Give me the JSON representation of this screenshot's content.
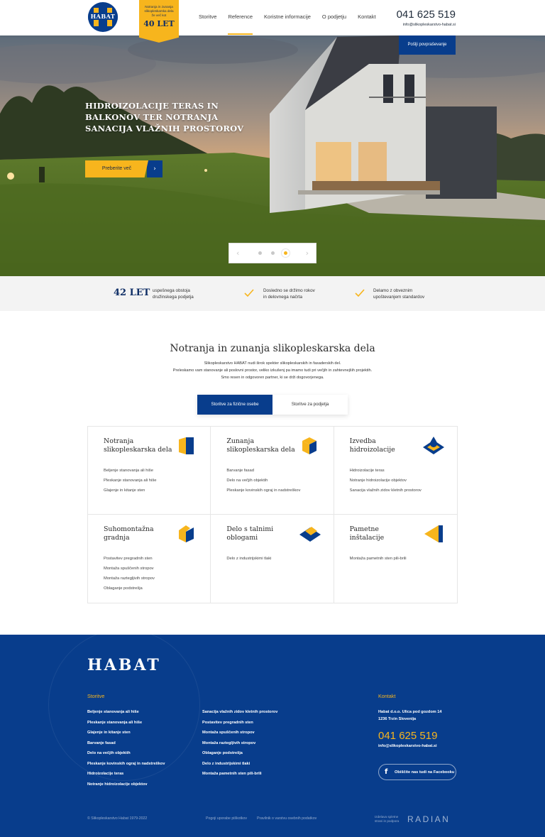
{
  "header": {
    "logo_text": "HABAT",
    "badge": {
      "line1": "Notranja in zunanja",
      "line2": "slikopleskarska dela",
      "line3": "že več kot",
      "big": "40 LET"
    },
    "nav": [
      {
        "label": "Storitve",
        "active": false
      },
      {
        "label": "Reference",
        "active": true
      },
      {
        "label": "Koristne informacije",
        "active": false
      },
      {
        "label": "O podjetju",
        "active": false
      },
      {
        "label": "Kontakt",
        "active": false
      }
    ],
    "phone": "041 625 519",
    "email": "info@slikopleskarstvo-habat.si",
    "inquiry_button": "Pošlji povpraševanje"
  },
  "hero": {
    "title": "HIDROIZOLACIJE TERAS IN BALKONOV TER NOTRANJA SANACIJA VLAŽNIH PROSTOROV",
    "button_label": "Preberite več",
    "button_arrow": "›",
    "slider": {
      "prev": "‹",
      "next": "›",
      "dots": 3,
      "active_index": 2
    }
  },
  "strip": {
    "years": "42 LET",
    "years_text_1": "uspešnega obstoja",
    "years_text_2": "družinskega podjetja",
    "item2_line1": "Dosledno se držimo rokov",
    "item2_line2": "in delovnega načrta",
    "item3_line1": "Delamo z obveznim",
    "item3_line2": "upoštevanjem standardov"
  },
  "services": {
    "title": "Notranja in zunanja slikopleskarska dela",
    "intro_1": "Slikopleskarstvo HABAT nudi širok spekter slikopleskarskih in fasaderskih del.",
    "intro_2": "Preleskamo vam stanovanje ali poslovni prostor, veliko izkušenj pa imamo tudi pri večjih in zahtevnejših projektih.",
    "intro_3": "Smo resen in odgovoren partner, ki se drži dogovorjenega.",
    "tab_active": "Storitve za fizične osebe",
    "tab_inactive": "Storitve za podjetja",
    "cards": [
      {
        "title1": "Notranja",
        "title2": "slikopleskarska dela",
        "icon": "door-icon",
        "items": [
          "Beljenje stanovanja ali hiše",
          "Pleskanje stanovanja ali hiše",
          "Glajenje in kitanje sten"
        ]
      },
      {
        "title1": "Zunanja",
        "title2": "slikopleskarska dela",
        "icon": "house-cube-icon",
        "items": [
          "Barvanje fasad",
          "Delo na večjih objektih",
          "Pleskanje kovinskih ograj in nadstreškov"
        ]
      },
      {
        "title1": "Izvedba",
        "title2": "hidroizolacije",
        "icon": "water-drop-icon",
        "items": [
          "Hidroizolacije teras",
          "Notranje hidroizolacije objektov",
          "Sanacija vlažnih zidov kletnih prostorov"
        ]
      },
      {
        "title1": "Suhomontažna",
        "title2": "gradnja",
        "icon": "drywall-icon",
        "items": [
          "Postavitev pregradnih sten",
          "Montaža spuščenih stropov",
          "Montaža raztegljivih stropov",
          "Oblaganje podstrešja"
        ]
      },
      {
        "title1": "Delo s talnimi",
        "title2": "oblogami",
        "icon": "floor-tile-icon",
        "items": [
          "Delo z industrijskimi tlaki"
        ]
      },
      {
        "title1": "Pametne",
        "title2": "inštalacije",
        "icon": "smart-wall-icon",
        "items": [
          "Montaža pametnih sten pili-brili"
        ]
      }
    ]
  },
  "footer": {
    "logo_text": "HABAT",
    "storitve_head": "Storitve",
    "col1": [
      "Beljenje stanovanja ali hiše",
      "Pleskanje stanovanja ali hiše",
      "Glajenje in kitanje sten",
      "Barvanje fasad",
      "Delo na večjih objektih",
      "Pleskanje kovinskih ograj in nadstreškov",
      "Hidroizolacije teras",
      "Notranje hidroizolacije objektov"
    ],
    "col2": [
      "Sanacija vlažnih zidov kletnih prostorov",
      "Postavitev pregradnih sten",
      "Montaža spuščenih stropov",
      "Montaža raztegljivih stropov",
      "Oblaganje podstrešja",
      "Delo z industrijskimi tlaki",
      "Montaža pametnih sten pili-brili"
    ],
    "kontakt_head": "Kontakt",
    "address_1": "Habat d.o.o. Ulica pod gozdom 14",
    "address_2": "1236 Trzin Slovenija",
    "phone": "041 625 519",
    "email": "info@slikopleskarstvo-habat.si",
    "facebook": "Obiščite nas tudi na Facebooku",
    "copyright": "© Slikopleskarstvo Habat 1979-2022",
    "terms": "Pogoji uporabe piškotkov",
    "privacy": "Pravilnik o varstvu osebnih podatkov",
    "credit_1": "Izdelava spletne",
    "credit_2": "strani in podpora",
    "radian": "RADIAN"
  },
  "colors": {
    "brand_blue": "#083d8c",
    "brand_yellow": "#f7b51d"
  }
}
